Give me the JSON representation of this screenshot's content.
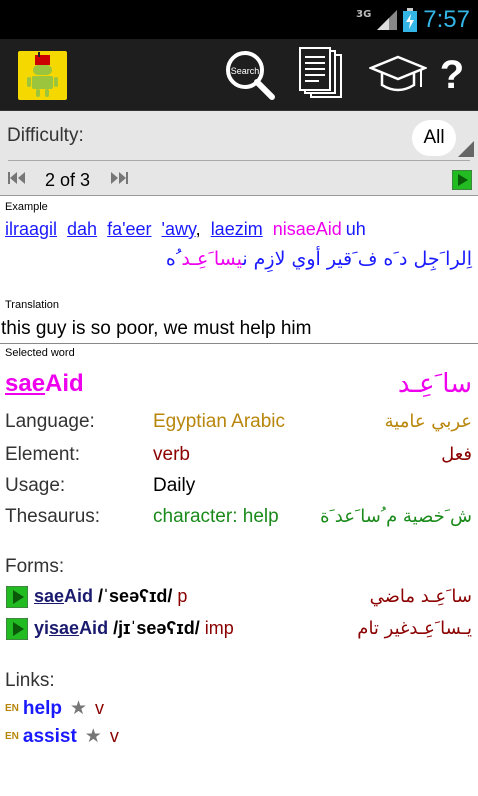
{
  "status": {
    "network": "3G",
    "time": "7:57"
  },
  "actionbar": {
    "search_label": "Search",
    "help_label": "?"
  },
  "difficulty": {
    "label": "Difficulty:",
    "value": "All"
  },
  "pager": {
    "text": "2 of 3"
  },
  "example": {
    "label": "Example",
    "words": [
      {
        "text": "ilraagil"
      },
      {
        "text": "dah"
      },
      {
        "text": "fa'eer"
      },
      {
        "text": "'awy"
      },
      {
        "text": "laezim"
      }
    ],
    "highlight_pre": "nisaeAid",
    "highlight_post": "uh",
    "comma": ",",
    "arabic_plain": "اِلرا َجِل د َه ف َقير أوي لازِم ن",
    "arabic_highlight": "يسا َعِـد",
    "arabic_tail": " ُه"
  },
  "translation": {
    "label": "Translation",
    "text": "this guy is so poor, we must help him"
  },
  "selected": {
    "label": "Selected word",
    "latin_pre": "sae",
    "latin_post": "Aid",
    "arabic": "سا َعِـد"
  },
  "details": [
    {
      "label": "Language:",
      "value": "Egyptian Arabic",
      "arabic": "عربي عامية",
      "color": "#b8860b",
      "ar_color": "#b8860b"
    },
    {
      "label": "Element:",
      "value": "verb",
      "arabic": "فعل",
      "color": "#8b0000",
      "ar_color": "#8b0000"
    },
    {
      "label": "Usage:",
      "value": "Daily",
      "arabic": "",
      "color": "#000000",
      "ar_color": "#000000"
    },
    {
      "label": "Thesaurus:",
      "value": "character: help",
      "arabic": "ش َخصية م ُسا َعد َة",
      "color": "#1a8a1a",
      "ar_color": "#1a8a1a"
    }
  ],
  "forms": {
    "label": "Forms:",
    "items": [
      {
        "pre": "",
        "ul": "sae",
        "post": "Aid",
        "ipa": " /ˈseəʕɪd/",
        "tag": " p",
        "arabic": "سا َعِـد ماضي"
      },
      {
        "pre": "yi",
        "ul": "sae",
        "post": "Aid",
        "ipa": " /jɪˈseəʕɪd/",
        "tag": " imp",
        "arabic": "يـسا َعِـدغير تام"
      }
    ]
  },
  "links": {
    "label": "Links:",
    "items": [
      {
        "lang": "EN",
        "word": "help",
        "pos": "v"
      },
      {
        "lang": "EN",
        "word": "assist",
        "pos": "v"
      }
    ]
  },
  "colors": {
    "accent_blue": "#1a1aff",
    "magenta": "#ee00ee",
    "play_green": "#22bb22"
  }
}
